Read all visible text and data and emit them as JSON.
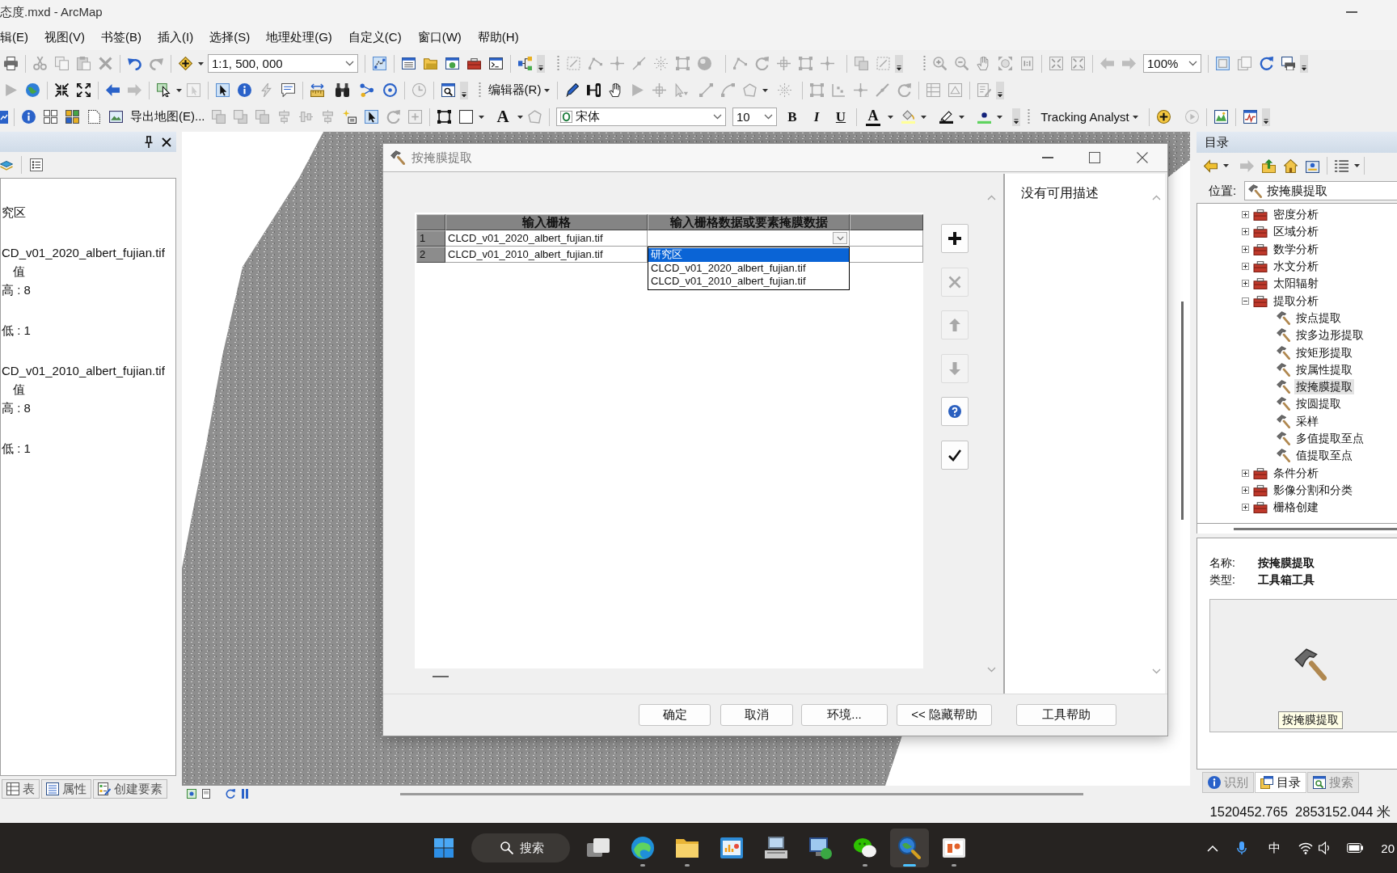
{
  "window": {
    "title": "态度.mxd - ArcMap"
  },
  "menu": [
    "辑(E)",
    "视图(V)",
    "书签(B)",
    "插入(I)",
    "选择(S)",
    "地理处理(G)",
    "自定义(C)",
    "窗口(W)",
    "帮助(H)"
  ],
  "toolbars": [
    {
      "controls": [
        {
          "kind": "combo",
          "value": "1:1, 500, 000"
        },
        {
          "kind": "combo",
          "value": "100%"
        }
      ]
    },
    {
      "controls": [
        {
          "kind": "menu",
          "label": "编辑器(R)"
        }
      ]
    },
    {
      "controls": [
        {
          "kind": "button",
          "label": "导出地图(E)..."
        },
        {
          "kind": "text_tool",
          "label": "A"
        },
        {
          "kind": "combo",
          "value": "宋体"
        },
        {
          "kind": "combo",
          "value": "10"
        },
        {
          "kind": "bold",
          "label": "B"
        },
        {
          "kind": "italic",
          "label": "I"
        },
        {
          "kind": "underline",
          "label": "U"
        },
        {
          "kind": "font_color",
          "label": "A"
        },
        {
          "kind": "menu",
          "label": "Tracking Analyst"
        }
      ]
    }
  ],
  "table_of_contents": {
    "layers": [
      {
        "name": "究区"
      },
      {
        "name": "CD_v01_2020_albert_fujian.tif",
        "legend": {
          "field": "值",
          "high": "高 : 8",
          "low": "低 : 1"
        }
      },
      {
        "name": "CD_v01_2010_albert_fujian.tif",
        "legend": {
          "field": "值",
          "high": "高 : 8",
          "low": "低 : 1"
        }
      }
    ],
    "buttons": [
      "表",
      "属性",
      "创建要素"
    ]
  },
  "dialog": {
    "title": "按掩膜提取",
    "table": {
      "columns": [
        "输入栅格",
        "输入栅格数据或要素掩膜数据"
      ],
      "rows": [
        {
          "number": "1",
          "input_raster": "CLCD_v01_2020_albert_fujian.tif",
          "mask_dropdown": {
            "expanded": true,
            "options": [
              {
                "label": "研究区",
                "selected": true
              },
              {
                "label": "CLCD_v01_2020_albert_fujian.tif",
                "selected": false
              },
              {
                "label": "CLCD_v01_2010_albert_fujian.tif",
                "selected": false
              }
            ]
          }
        },
        {
          "number": "2",
          "input_raster": "CLCD_v01_2010_albert_fujian.tif"
        }
      ]
    },
    "side_buttons": [
      {
        "kind": "add",
        "disabled": false
      },
      {
        "kind": "remove",
        "disabled": true
      },
      {
        "kind": "up",
        "disabled": true
      },
      {
        "kind": "down",
        "disabled": true
      },
      {
        "kind": "help",
        "disabled": false
      },
      {
        "kind": "check",
        "disabled": false
      }
    ],
    "help_text": "没有可用描述",
    "buttons": [
      "确定",
      "取消",
      "环境...",
      "<< 隐藏帮助",
      "工具帮助"
    ]
  },
  "catalog": {
    "title": "目录",
    "location_label": "位置:",
    "location": "按掩膜提取",
    "tree": [
      {
        "label": "密度分析",
        "expanded": false,
        "selected": false
      },
      {
        "label": "区域分析",
        "expanded": false,
        "selected": false
      },
      {
        "label": "数学分析",
        "expanded": false,
        "selected": false
      },
      {
        "label": "水文分析",
        "expanded": false,
        "selected": false
      },
      {
        "label": "太阳辐射",
        "expanded": false,
        "selected": false
      },
      {
        "label": "提取分析",
        "expanded": true,
        "selected": false,
        "children": [
          {
            "label": "按点提取",
            "selected": false
          },
          {
            "label": "按多边形提取",
            "selected": false
          },
          {
            "label": "按矩形提取",
            "selected": false
          },
          {
            "label": "按属性提取",
            "selected": false
          },
          {
            "label": "按掩膜提取",
            "selected": true
          },
          {
            "label": "按圆提取",
            "selected": false
          },
          {
            "label": "采样",
            "selected": false
          },
          {
            "label": "多值提取至点",
            "selected": false
          },
          {
            "label": "值提取至点",
            "selected": false
          }
        ]
      },
      {
        "label": "条件分析",
        "expanded": false,
        "selected": false
      },
      {
        "label": "影像分割和分类",
        "expanded": false,
        "selected": false
      },
      {
        "label": "栅格创建",
        "expanded": false,
        "selected": false
      }
    ],
    "details": [
      {
        "label": "名称:",
        "value": "按掩膜提取"
      },
      {
        "label": "类型:",
        "value": "工具箱工具"
      }
    ],
    "preview_caption": "按掩膜提取",
    "tabs": [
      {
        "label": "识别",
        "selected": false
      },
      {
        "label": "目录",
        "selected": true
      },
      {
        "label": "搜索",
        "selected": false
      }
    ]
  },
  "status_bar": {
    "coordinates": "1520452.765  2853152.044 米"
  },
  "taskbar": {
    "search": "搜索",
    "apps": [
      {
        "running": false,
        "selected": false
      },
      {
        "running": true,
        "selected": false
      },
      {
        "running": true,
        "selected": false
      },
      {
        "running": false,
        "selected": false
      },
      {
        "running": false,
        "selected": false
      },
      {
        "running": false,
        "selected": false
      },
      {
        "running": true,
        "selected": false
      },
      {
        "running": true,
        "selected": true
      },
      {
        "running": true,
        "selected": false
      }
    ],
    "input_method": "中",
    "clock": "20"
  }
}
